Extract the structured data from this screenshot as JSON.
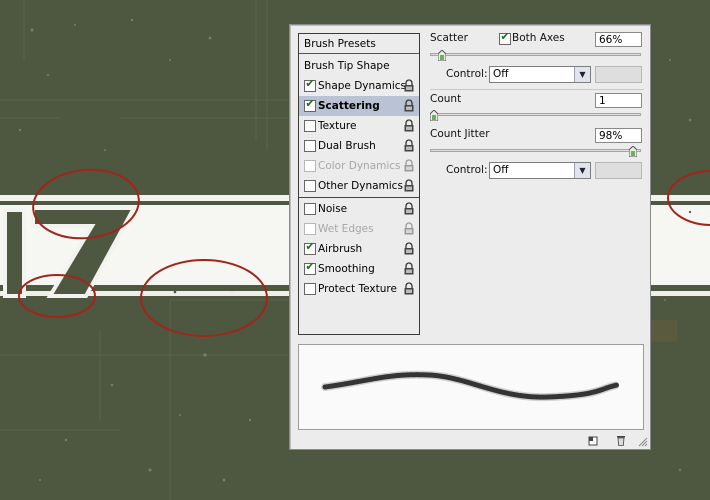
{
  "canvas": {
    "background_color": "#4e5740",
    "artwork_numerals": "17",
    "highlight_color": "#a3241b"
  },
  "panel": {
    "sections": [
      {
        "label": "Brush Presets",
        "kind": "header"
      },
      {
        "label": "Brush Tip Shape",
        "kind": "plain"
      },
      {
        "label": "Shape Dynamics",
        "checked": true,
        "enabled": true
      },
      {
        "label": "Scattering",
        "checked": true,
        "enabled": true,
        "selected": true
      },
      {
        "label": "Texture",
        "checked": false,
        "enabled": true
      },
      {
        "label": "Dual Brush",
        "checked": false,
        "enabled": true
      },
      {
        "label": "Color Dynamics",
        "checked": false,
        "enabled": false
      },
      {
        "label": "Other Dynamics",
        "checked": false,
        "enabled": true
      },
      {
        "label": "Noise",
        "checked": false,
        "enabled": true
      },
      {
        "label": "Wet Edges",
        "checked": false,
        "enabled": false
      },
      {
        "label": "Airbrush",
        "checked": true,
        "enabled": true
      },
      {
        "label": "Smoothing",
        "checked": true,
        "enabled": true
      },
      {
        "label": "Protect Texture",
        "checked": false,
        "enabled": true
      }
    ],
    "scattering": {
      "scatter_label": "Scatter",
      "both_axes_label": "Both Axes",
      "both_axes_checked": true,
      "scatter_value": "66%",
      "scatter_slider_level": 0.04,
      "control1_label": "Control:",
      "control1_value": "Off",
      "count_label": "Count",
      "count_value": "1",
      "count_slider_level": 0.0,
      "count_jitter_label": "Count Jitter",
      "count_jitter_value": "98%",
      "count_jitter_slider_level": 0.98,
      "control2_label": "Control:",
      "control2_value": "Off"
    },
    "icons": {
      "lock": "lock-icon",
      "new_preset": "new-preset-icon",
      "trash": "trash-icon",
      "resize": "resize-grip-icon"
    }
  }
}
